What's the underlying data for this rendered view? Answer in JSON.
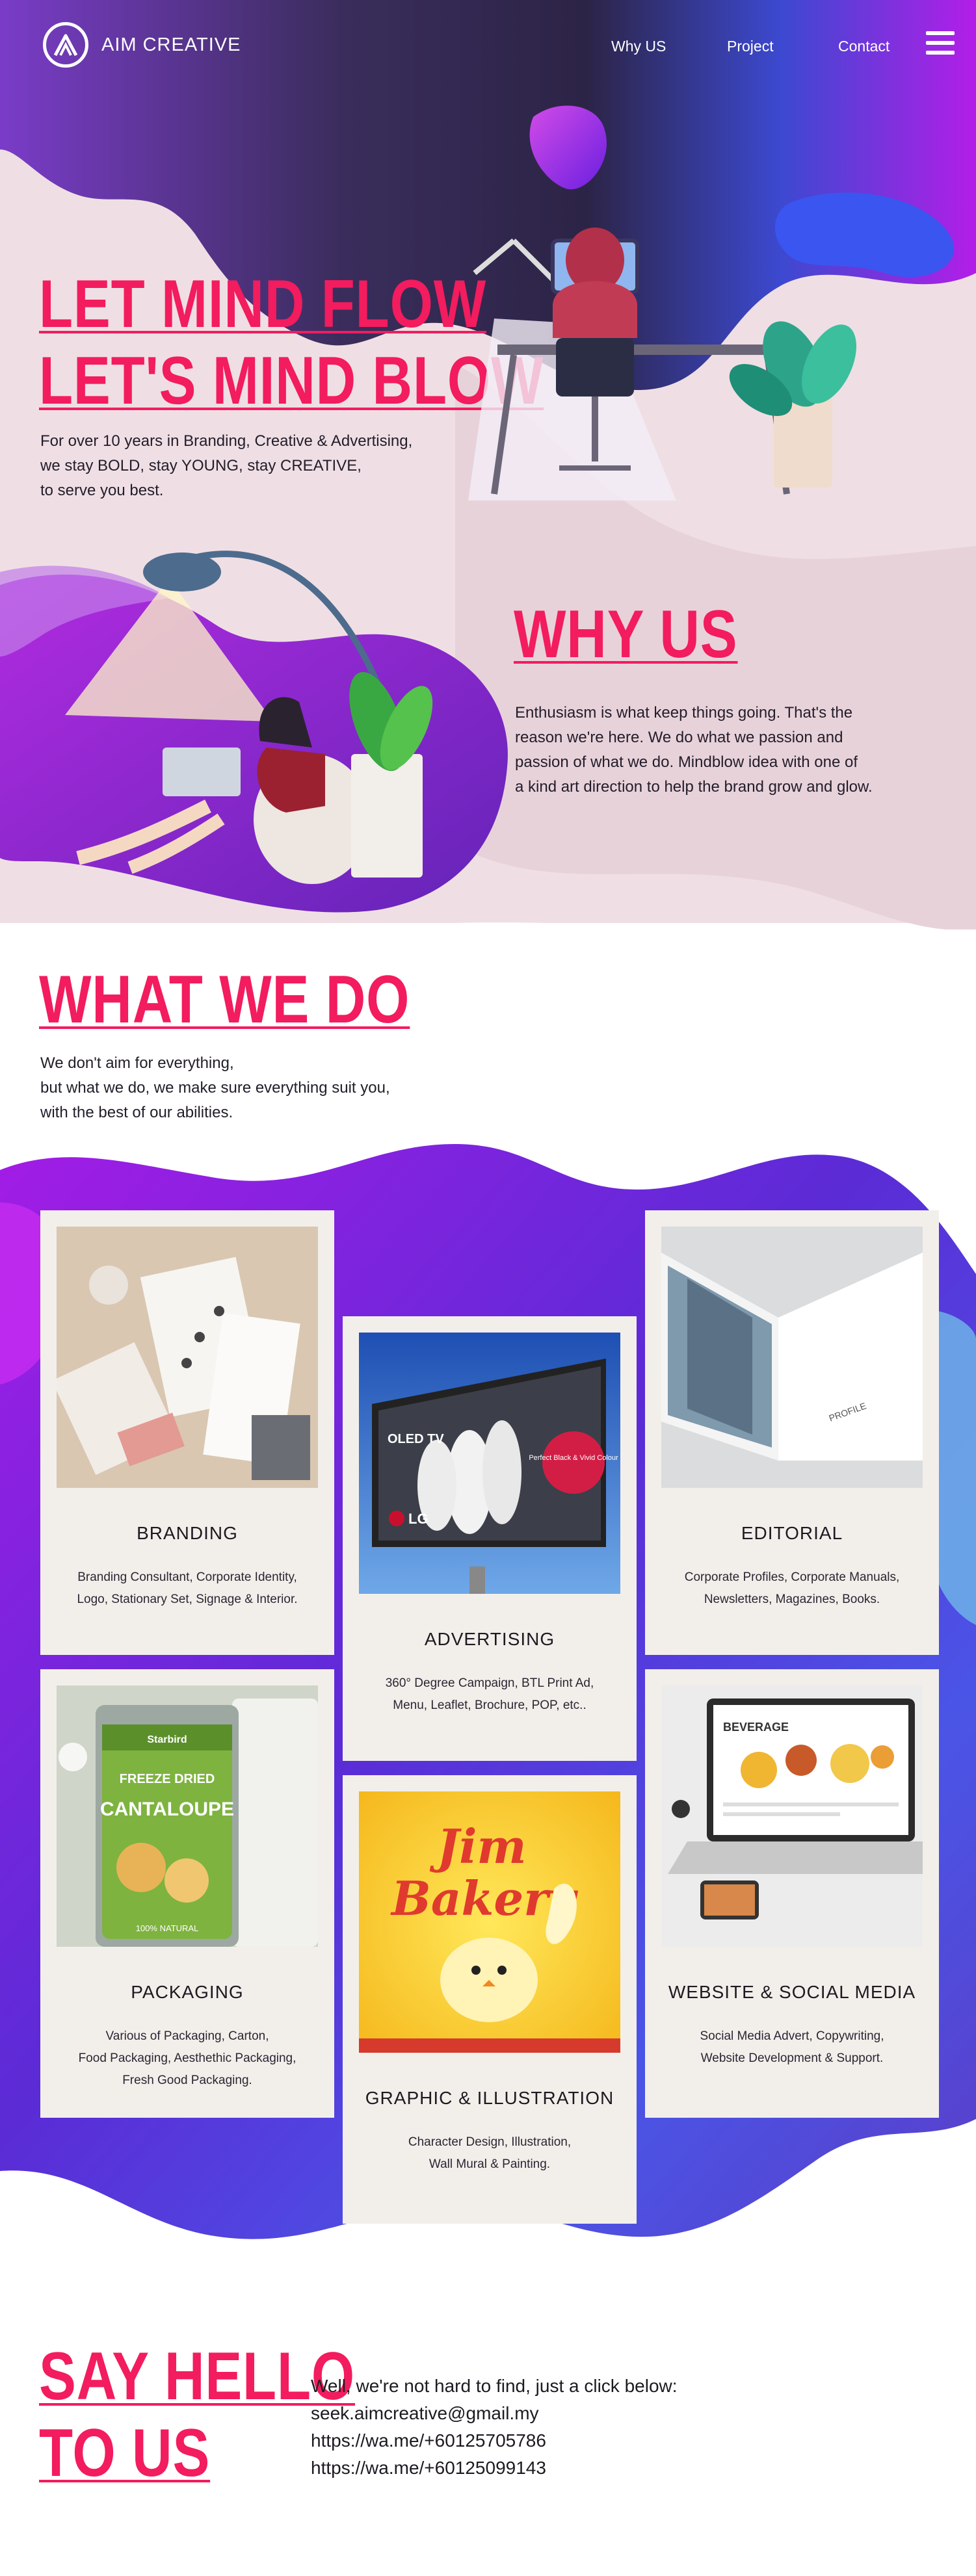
{
  "brand": {
    "name": "AIM CREATIVE"
  },
  "nav": {
    "items": [
      "Why US",
      "Project",
      "Contact"
    ]
  },
  "hero": {
    "headline_1": "LET MIND FLOW",
    "headline_2": "LET'S MIND BLOW",
    "lines": [
      "For over 10 years in Branding, Creative & Advertising,",
      "we stay BOLD, stay YOUNG, stay CREATIVE,",
      "to serve you best."
    ]
  },
  "why_us": {
    "heading": "WHY US",
    "lines": [
      "Enthusiasm is what keep things going. That's the",
      "reason we're here. We do what we passion and",
      "passion of what we do. Mindblow idea with one of",
      "a kind art direction to help the brand grow and glow."
    ]
  },
  "what_we_do": {
    "heading": "WHAT WE DO",
    "lines": [
      "We don't aim for everything,",
      "but what we do, we make sure everything suit you,",
      "with the best of our abilities."
    ]
  },
  "services": [
    {
      "title": "BRANDING",
      "desc": [
        "Branding Consultant, Corporate Identity,",
        "Logo, Stationary Set, Signage & Interior."
      ]
    },
    {
      "title": "ADVERTISING",
      "desc": [
        "360° Degree Campaign, BTL Print Ad,",
        "Menu, Leaflet, Brochure, POP, etc.."
      ]
    },
    {
      "title": "EDITORIAL",
      "desc": [
        "Corporate Profiles,  Corporate Manuals,",
        "Newsletters, Magazines, Books."
      ]
    },
    {
      "title": "PACKAGING",
      "desc": [
        "Various of Packaging, Carton,",
        "Food Packaging, Aesthethic Packaging,",
        "Fresh Good Packaging."
      ]
    },
    {
      "title": "GRAPHIC & ILLUSTRATION",
      "desc": [
        "Character Design, Illustration,",
        "Wall Mural & Painting."
      ]
    },
    {
      "title": "WEBSITE & SOCIAL MEDIA",
      "desc": [
        "Social Media Advert, Copywriting,",
        "Website Development & Support."
      ]
    }
  ],
  "image_text": {
    "billboard_brand": "OLED TV",
    "billboard_logo": "LG",
    "billboard_badge": "Perfect Black & Vivid Colour",
    "pack_brand": "Starbird",
    "pack_line1": "FREEZE DRIED",
    "pack_product": "CANTALOUPE",
    "pack_footer": "100% NATURAL",
    "bakery_line1": "Jim",
    "bakery_line2": "Bakery",
    "web_heading": "BEVERAGE"
  },
  "contact": {
    "heading_1": "SAY HELLO",
    "heading_2": "TO US",
    "intro": "Well, we're not hard to find, just a click below:",
    "email": "seek.aimcreative@gmail.my",
    "link_1": "https://wa.me/+60125705786",
    "link_2": "https://wa.me/+60125099143"
  },
  "colors": {
    "accent": "#f21c5e",
    "hero_bg": "#efdfe4",
    "deep_purple": "#2e2748",
    "violet": "#8b1fe0",
    "card_bg": "#f2efeb"
  }
}
